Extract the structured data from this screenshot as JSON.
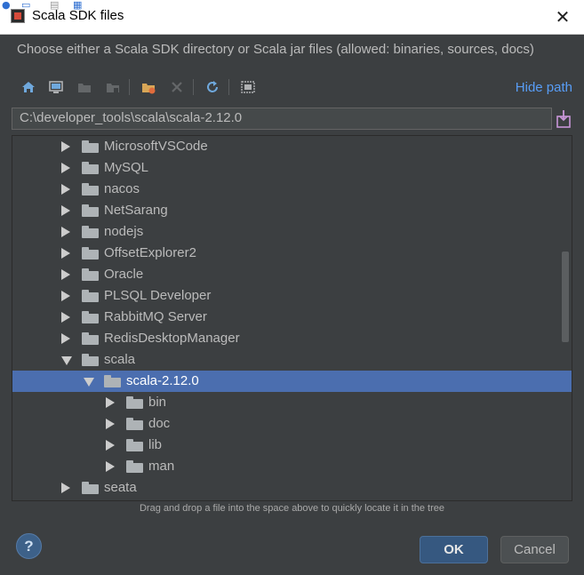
{
  "window": {
    "title": "Scala SDK files",
    "close_glyph": "✕"
  },
  "description": "Choose either a Scala SDK directory or Scala jar files (allowed: binaries, sources, docs)",
  "toolbar": {
    "buttons": [
      {
        "icon": "home-icon",
        "enabled": true
      },
      {
        "icon": "desktop-icon",
        "enabled": true
      },
      {
        "icon": "project-folder-icon",
        "enabled": false
      },
      {
        "icon": "module-folder-icon",
        "enabled": false
      },
      {
        "icon": "new-folder-icon",
        "enabled": true
      },
      {
        "icon": "delete-icon",
        "enabled": false
      },
      {
        "icon": "refresh-icon",
        "enabled": true
      },
      {
        "icon": "show-hidden-icon",
        "enabled": true
      }
    ],
    "hide_path_label": "Hide path"
  },
  "path": {
    "value": "C:\\developer_tools\\scala\\scala-2.12.0"
  },
  "tree": {
    "items": [
      {
        "label": "MicrosoftVSCode",
        "level": 0,
        "expanded": false,
        "selected": false
      },
      {
        "label": "MySQL",
        "level": 0,
        "expanded": false,
        "selected": false
      },
      {
        "label": "nacos",
        "level": 0,
        "expanded": false,
        "selected": false
      },
      {
        "label": "NetSarang",
        "level": 0,
        "expanded": false,
        "selected": false
      },
      {
        "label": "nodejs",
        "level": 0,
        "expanded": false,
        "selected": false
      },
      {
        "label": "OffsetExplorer2",
        "level": 0,
        "expanded": false,
        "selected": false
      },
      {
        "label": "Oracle",
        "level": 0,
        "expanded": false,
        "selected": false
      },
      {
        "label": "PLSQL Developer",
        "level": 0,
        "expanded": false,
        "selected": false
      },
      {
        "label": "RabbitMQ Server",
        "level": 0,
        "expanded": false,
        "selected": false
      },
      {
        "label": "RedisDesktopManager",
        "level": 0,
        "expanded": false,
        "selected": false
      },
      {
        "label": "scala",
        "level": 0,
        "expanded": true,
        "selected": false
      },
      {
        "label": "scala-2.12.0",
        "level": 1,
        "expanded": true,
        "selected": true
      },
      {
        "label": "bin",
        "level": 2,
        "expanded": false,
        "selected": false
      },
      {
        "label": "doc",
        "level": 2,
        "expanded": false,
        "selected": false
      },
      {
        "label": "lib",
        "level": 2,
        "expanded": false,
        "selected": false
      },
      {
        "label": "man",
        "level": 2,
        "expanded": false,
        "selected": false
      },
      {
        "label": "seata",
        "level": 0,
        "expanded": false,
        "selected": false
      }
    ]
  },
  "hint": "Drag and drop a file into the space above to quickly locate it in the tree",
  "buttons": {
    "help_label": "?",
    "ok_label": "OK",
    "cancel_label": "Cancel"
  },
  "colors": {
    "background": "#3c3f41",
    "selection": "#4b6eaf",
    "link": "#589df6",
    "ok_button": "#365880"
  }
}
